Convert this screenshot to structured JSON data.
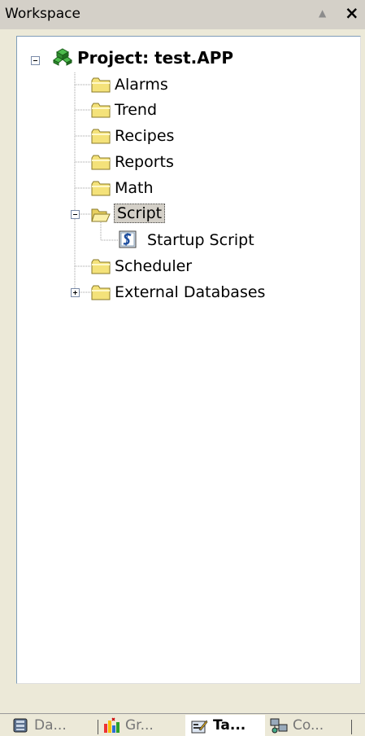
{
  "window": {
    "title": "Workspace",
    "pin_glyph": "▲",
    "close_glyph": "×"
  },
  "tree": {
    "root": {
      "label": "Project: test.APP",
      "icon": "project-icon",
      "expanded": true
    },
    "items": [
      {
        "label": "Alarms",
        "icon": "folder-icon"
      },
      {
        "label": "Trend",
        "icon": "folder-icon"
      },
      {
        "label": "Recipes",
        "icon": "folder-icon"
      },
      {
        "label": "Reports",
        "icon": "folder-icon"
      },
      {
        "label": "Math",
        "icon": "folder-icon"
      },
      {
        "label": "Script",
        "icon": "open-folder-icon",
        "expanded": true,
        "selected": true,
        "children": [
          {
            "label": "Startup Script",
            "icon": "script-icon"
          }
        ]
      },
      {
        "label": "Scheduler",
        "icon": "folder-icon"
      },
      {
        "label": "External Databases",
        "icon": "folder-icon",
        "expanded": false
      }
    ]
  },
  "tabs": [
    {
      "label": "Da...",
      "icon": "database-icon",
      "active": false
    },
    {
      "label": "Gr...",
      "icon": "graphics-icon",
      "active": false
    },
    {
      "label": "Ta...",
      "icon": "tasks-icon",
      "active": true
    },
    {
      "label": "Co...",
      "icon": "comm-icon",
      "active": false
    }
  ],
  "colors": {
    "folder": "#f4e27a",
    "selection": "#d4d0c8",
    "titlebar": "#d4d0c8"
  }
}
